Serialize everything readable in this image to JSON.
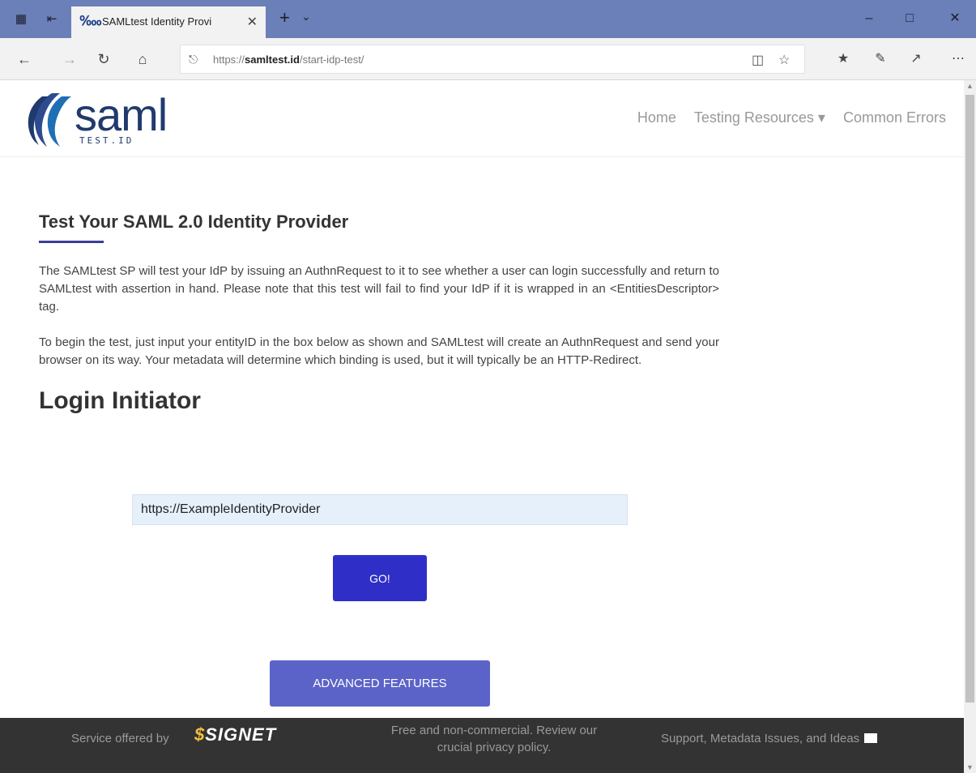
{
  "browser": {
    "tab_title": "SAMLtest Identity Provi",
    "url_prefix": "https://",
    "url_host": "samltest.id",
    "url_path": "/start-idp-test/"
  },
  "header": {
    "logo_word": "saml",
    "logo_sub": "TEST.ID",
    "nav": [
      "Home",
      "Testing Resources ▾",
      "Common Errors"
    ]
  },
  "main": {
    "heading": "Test Your SAML 2.0 Identity Provider",
    "para1": "The SAMLtest SP will test your IdP by issuing an AuthnRequest to it to see whether a user can login successfully and return to SAMLtest with assertion in hand. Please note that this test will fail to find your IdP if it is wrapped in an <EntitiesDescriptor> tag.",
    "para2": "To begin the test, just input your entityID in the box below as shown and SAMLtest will create an AuthnRequest and send your browser on its way. Your metadata will determine which binding is used, but it will typically be an HTTP-Redirect.",
    "login_heading": "Login Initiator",
    "entity_input": "https://ExampleIdentityProvider",
    "go_label": "GO!",
    "advanced_label": "ADVANCED FEATURES"
  },
  "footer": {
    "offered_by": "Service offered by",
    "signet": "SIGNET",
    "privacy_line1": "Free and non-commercial. Review our",
    "privacy_line2": "crucial privacy policy.",
    "support": "Support, Metadata Issues, and Ideas"
  },
  "colors": {
    "titlebar": "#6b7fb8",
    "go_button": "#2f2fc8",
    "advanced_button": "#5c63c8",
    "footer": "#333333"
  }
}
